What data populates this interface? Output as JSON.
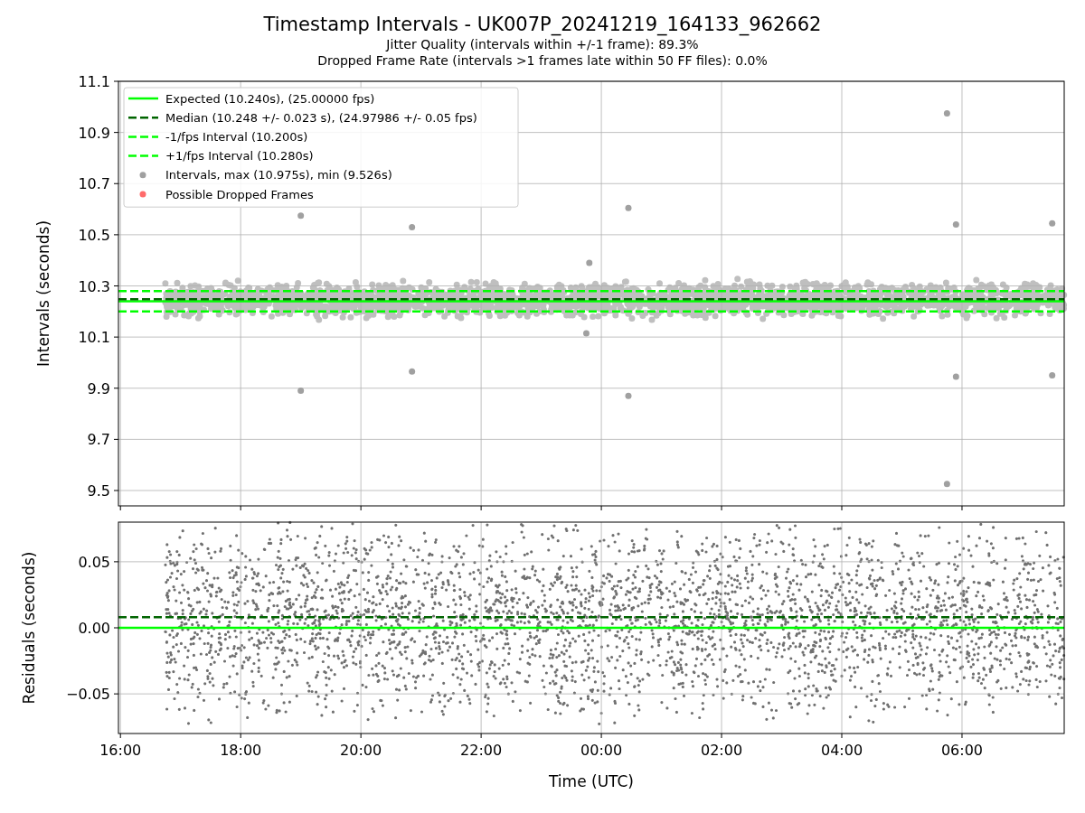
{
  "figure": {
    "title": "Timestamp Intervals - UK007P_20241219_164133_962662",
    "subtitles": [
      "Jitter Quality (intervals within +/-1 frame): 89.3%",
      "Dropped Frame Rate (intervals >1 frames late within 50 FF files): 0.0%"
    ]
  },
  "charts": [
    {
      "chart_data": {
        "type": "scatter",
        "ylabel": "Intervals (seconds)",
        "grid": true,
        "legend": true,
        "xlim": [
          "2024-12-19T15:58",
          "2024-12-20T07:42"
        ],
        "ylim": [
          9.44,
          11.1
        ],
        "yticks": [
          {
            "value": 9.5,
            "label": "9.5"
          },
          {
            "value": 9.7,
            "label": "9.7"
          },
          {
            "value": 9.9,
            "label": "9.9"
          },
          {
            "value": 10.1,
            "label": "10.1"
          },
          {
            "value": 10.3,
            "label": "10.3"
          },
          {
            "value": 10.5,
            "label": "10.5"
          },
          {
            "value": 10.7,
            "label": "10.7"
          },
          {
            "value": 10.9,
            "label": "10.9"
          },
          {
            "value": 11.1,
            "label": "11.1"
          }
        ],
        "series": [
          {
            "name": "Expected (10.240s), (25.00000 fps)",
            "type": "line",
            "line_style": "solid",
            "color": "#00ff00",
            "x": [
              "2024-12-19T15:58",
              "2024-12-20T07:42"
            ],
            "values": [
              10.24,
              10.24
            ]
          },
          {
            "name": "Median (10.248 +/- 0.023 s), (24.97986 +/- 0.05 fps)",
            "type": "line",
            "line_style": "dashed",
            "color": "#006400",
            "x": [
              "2024-12-19T15:58",
              "2024-12-20T07:42"
            ],
            "values": [
              10.248,
              10.248
            ]
          },
          {
            "name": "-1/fps Interval (10.200s)",
            "type": "line",
            "line_style": "dashed",
            "color": "#00ff00",
            "x": [
              "2024-12-19T15:58",
              "2024-12-20T07:42"
            ],
            "values": [
              10.2,
              10.2
            ]
          },
          {
            "name": "+1/fps Interval (10.280s)",
            "type": "line",
            "line_style": "dashed",
            "color": "#00ff00",
            "x": [
              "2024-12-19T15:58",
              "2024-12-20T07:42"
            ],
            "values": [
              10.28,
              10.28
            ]
          },
          {
            "name": "Intervals, max (10.975s), min (9.526s)",
            "type": "scatter",
            "color": "#a0a0a0",
            "x": [
              "2024-12-19T19:00",
              "2024-12-19T19:00",
              "2024-12-19T20:51",
              "2024-12-19T20:51",
              "2024-12-19T23:45",
              "2024-12-19T23:48",
              "2024-12-20T00:27",
              "2024-12-20T00:27",
              "2024-12-20T05:45",
              "2024-12-20T05:45",
              "2024-12-20T05:54",
              "2024-12-20T05:54",
              "2024-12-20T07:30",
              "2024-12-20T07:30"
            ],
            "values": [
              10.575,
              9.89,
              10.53,
              9.965,
              10.115,
              10.39,
              10.605,
              9.87,
              10.975,
              9.526,
              10.54,
              9.945,
              10.545,
              9.95
            ]
          },
          {
            "name": "Possible Dropped Frames",
            "type": "scatter",
            "color": "#ff6b6b"
          }
        ]
      }
    },
    {
      "chart_data": {
        "type": "scatter",
        "xlabel": "Time (UTC)",
        "ylabel": "Residuals (seconds)",
        "grid": true,
        "xlim": [
          "2024-12-19T15:58",
          "2024-12-20T07:42"
        ],
        "ylim": [
          -0.08,
          0.08
        ],
        "xticks": [
          {
            "value": "2024-12-19T16:00",
            "label": "16:00"
          },
          {
            "value": "2024-12-19T18:00",
            "label": "18:00"
          },
          {
            "value": "2024-12-19T20:00",
            "label": "20:00"
          },
          {
            "value": "2024-12-19T22:00",
            "label": "22:00"
          },
          {
            "value": "2024-12-20T00:00",
            "label": "00:00"
          },
          {
            "value": "2024-12-20T02:00",
            "label": "02:00"
          },
          {
            "value": "2024-12-20T04:00",
            "label": "04:00"
          },
          {
            "value": "2024-12-20T06:00",
            "label": "06:00"
          }
        ],
        "yticks": [
          {
            "value": -0.05,
            "label": "−0.05"
          },
          {
            "value": 0,
            "label": "0.00"
          },
          {
            "value": 0.05,
            "label": "0.05"
          }
        ],
        "series": [
          {
            "type": "line",
            "line_style": "solid",
            "color": "#00ff00",
            "x": [
              "2024-12-19T15:58",
              "2024-12-20T07:42"
            ],
            "values": [
              0,
              0
            ]
          },
          {
            "type": "line",
            "line_style": "dashed",
            "color": "#006400",
            "x": [
              "2024-12-19T15:58",
              "2024-12-20T07:42"
            ],
            "values": [
              0.008,
              0.008
            ]
          }
        ]
      }
    }
  ]
}
